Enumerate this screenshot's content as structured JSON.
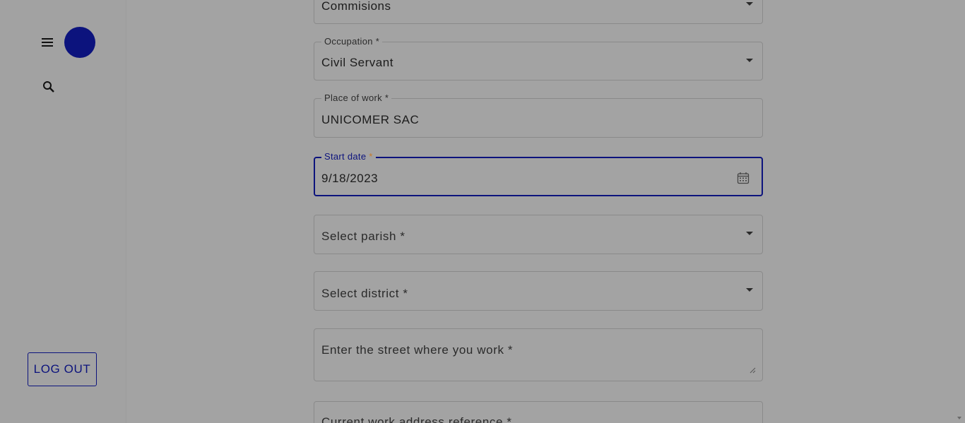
{
  "sidebar": {
    "logout_label": "LOG OUT",
    "menu_icon": "menu-icon",
    "search_icon": "search-icon"
  },
  "form": {
    "payment_type": {
      "value": "Commisions"
    },
    "occupation": {
      "label": "Occupation",
      "required_mark": "*",
      "value": "Civil Servant"
    },
    "place_of_work": {
      "label": "Place of work",
      "required_mark": "*",
      "value": "UNICOMER SAC"
    },
    "start_date": {
      "label": "Start date",
      "required_mark": "*",
      "value": "9/18/2023"
    },
    "parish": {
      "placeholder": "Select parish *"
    },
    "district": {
      "placeholder": "Select district *"
    },
    "street": {
      "placeholder": "Enter the street where you work *"
    },
    "address_reference": {
      "placeholder": "Current work address reference *"
    }
  },
  "colors": {
    "accent": "#0c137d",
    "overlay_background": "#a3a3a3",
    "required_star": "#c77a2a"
  }
}
